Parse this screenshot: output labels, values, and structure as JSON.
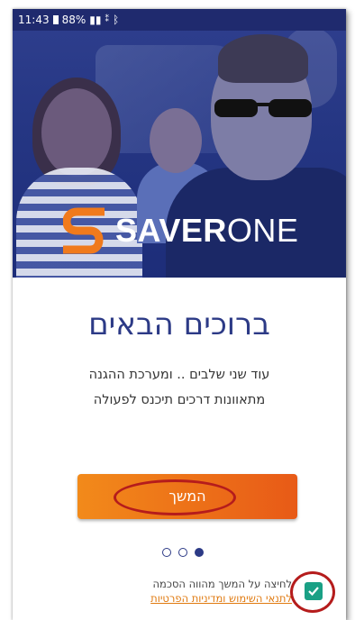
{
  "statusbar": {
    "time": "11:43",
    "battery": "88%",
    "signal_icon": "signal-icon",
    "bluetooth_icon": "bluetooth-icon"
  },
  "logo": {
    "bold": "SAVER",
    "thin": "ONE",
    "accent_color": "#f07a1c"
  },
  "welcome": {
    "title": "ברוכים הבאים",
    "line1": "עוד שני שלבים .. ומערכת ההגנה",
    "line2": "מתאוונות דרכים תיכנס לפעולה"
  },
  "continue_button": {
    "label": "המשך",
    "color_start": "#f28a1a",
    "color_end": "#e85a17"
  },
  "pagination": {
    "total": 3,
    "active_index": 2
  },
  "consent": {
    "text": "לחיצה על המשך מהווה הסכמה",
    "link": "לתנאי השימוש ומדיניות הפרטיות",
    "checked": true
  },
  "colors": {
    "brand_blue": "#2c3a86",
    "hero_blue": "#253683",
    "checkbox_green": "#1aa085",
    "annotation_red": "#b51c1c"
  }
}
